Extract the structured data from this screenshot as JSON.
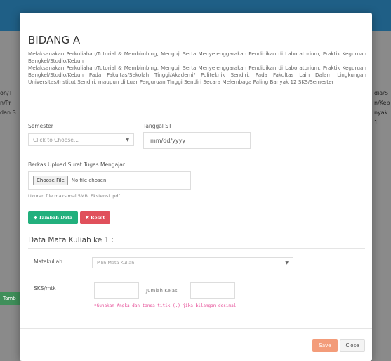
{
  "background": {
    "left_peek": [
      "on/T",
      "n/Pr",
      "dan S"
    ],
    "right_peek": [
      "dia/S",
      "n/Keb",
      "nyak 1"
    ],
    "green_btn_fragment": "Tamb"
  },
  "modal": {
    "title": "BIDANG A",
    "desc_short": "Melaksanakan Perkuliahan/Tutorial & Membimbing, Menguji Serta Menyelenggarakan Pendidikan di Laboratorium, Praktik Keguruan Bengkel/Studio/Kebun",
    "desc_long": "Melaksanakan Perkuliahan/Tutorial & Membimbing, Menguji Serta Menyelenggarakan Pendidikan di Laboratorium, Praktik Keguruan Bengkel/Studio/Kebun Pada Fakultas/Sekolah Tinggi/Akademi/ Politeknik Sendiri, Pada Fakultas Lain Dalam Lingkungan Universitas/Institut Sendiri, maupun di Luar Perguruan Tinggi Sendiri Secara Melembaga Paling Banyak 12 SKS/Semester",
    "semester": {
      "label": "Semester",
      "placeholder": "Click to Choose..."
    },
    "tanggal_st": {
      "label": "Tanggal ST",
      "placeholder": "mm/dd/yyyy"
    },
    "upload": {
      "label": "Berkas Upload Surat Tugas Mengajar",
      "button": "Choose File",
      "status": "No file chosen",
      "hint": "Ukuran file maksimal 5MB. Ekstensi .pdf"
    },
    "buttons": {
      "add": "Tambah Data",
      "reset": "Reset",
      "save": "Save",
      "close": "Close"
    },
    "section_title": "Data Mata Kuliah ke 1 :",
    "matakuliah": {
      "label": "Matakuliah",
      "placeholder": "Pilih Mata Kuliah"
    },
    "sks": {
      "label": "SKS/mtk",
      "value": ""
    },
    "jumlah_kelas": {
      "placeholder": "Jumlah Kelas"
    },
    "note": "*Gunakan Angka dan tanda titik (.) jika bilangan desimal"
  }
}
